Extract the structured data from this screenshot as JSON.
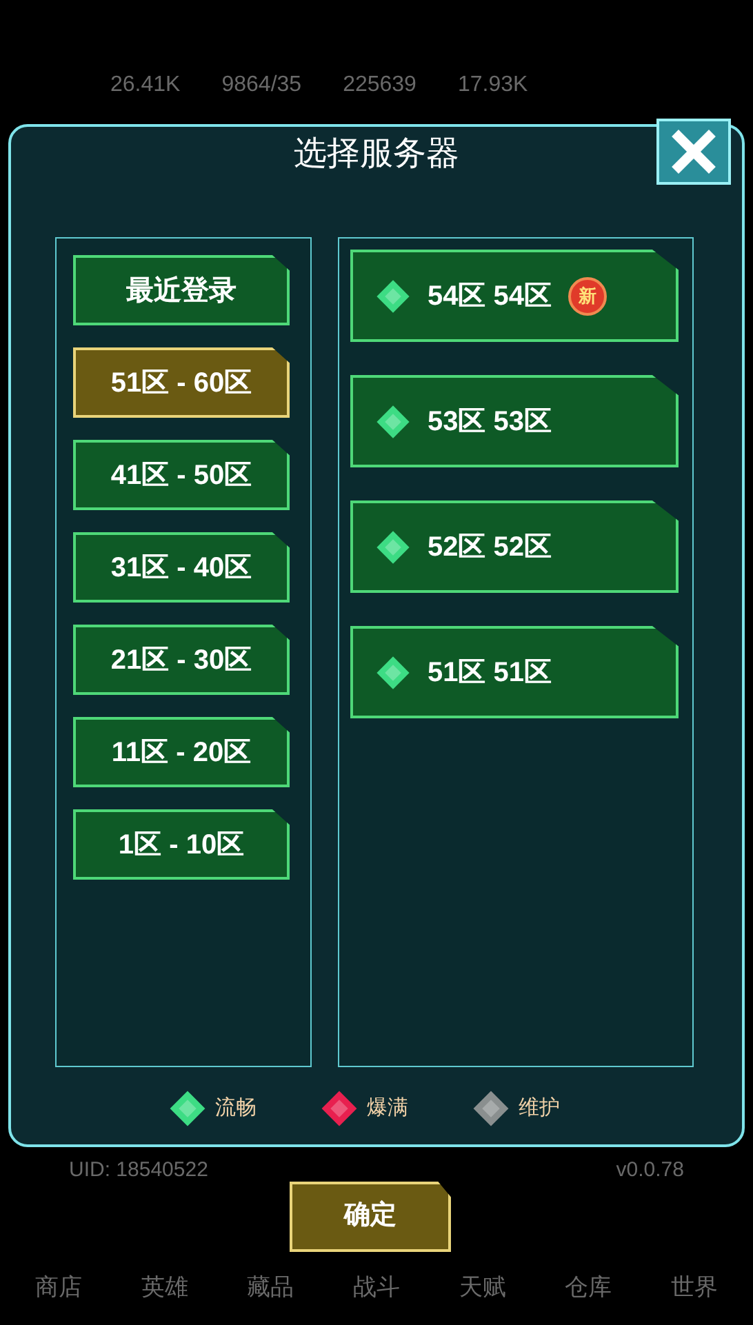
{
  "stats": [
    "26.41K",
    "9864/35",
    "225639",
    "17.93K"
  ],
  "dialog": {
    "title": "选择服务器",
    "groups": [
      {
        "label": "最近登录",
        "selected": false
      },
      {
        "label": "51区 - 60区",
        "selected": true
      },
      {
        "label": "41区 - 50区",
        "selected": false
      },
      {
        "label": "31区 - 40区",
        "selected": false
      },
      {
        "label": "21区 - 30区",
        "selected": false
      },
      {
        "label": "11区 - 20区",
        "selected": false
      },
      {
        "label": "1区 - 10区",
        "selected": false
      }
    ],
    "servers": [
      {
        "name": "54区 54区",
        "color": "#3ddc84",
        "new": true,
        "badge": "新"
      },
      {
        "name": "53区 53区",
        "color": "#3ddc84",
        "new": false
      },
      {
        "name": "52区 52区",
        "color": "#3ddc84",
        "new": false
      },
      {
        "name": "51区 51区",
        "color": "#3ddc84",
        "new": false
      }
    ],
    "legend": [
      {
        "label": "流畅",
        "color": "#3ddc84"
      },
      {
        "label": "爆满",
        "color": "#e8204f"
      },
      {
        "label": "维护",
        "color": "#8a8f8f"
      }
    ]
  },
  "uid": "UID: 18540522",
  "version": "v0.0.78",
  "confirm": "确定",
  "nav": [
    "商店",
    "英雄",
    "藏品",
    "战斗",
    "天赋",
    "仓库",
    "世界"
  ]
}
